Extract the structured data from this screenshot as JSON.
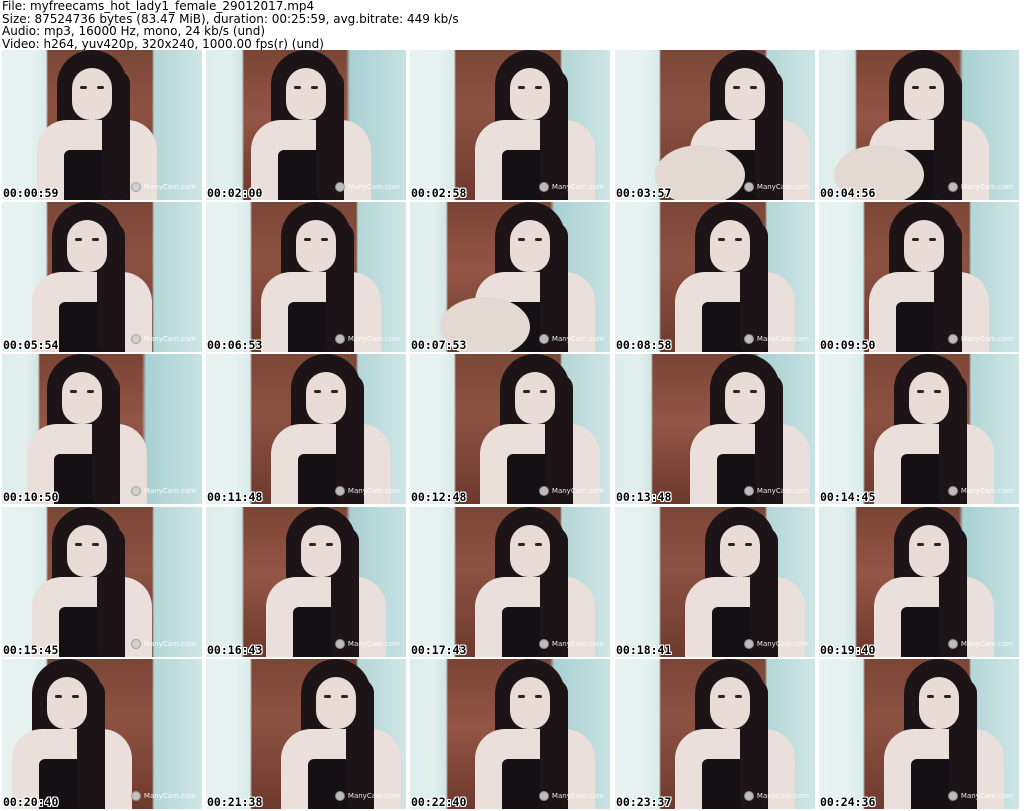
{
  "header": {
    "file_line": "File: myfreecams_hot_lady1_female_29012017.mp4",
    "size_line": "Size: 87524736 bytes (83.47 MiB), duration: 00:25:59, avg.bitrate: 449 kb/s",
    "audio_line": "Audio: mp3, 16000 Hz, mono, 24 kb/s (und)",
    "video_line": "Video: h264, yuv420p, 320x240, 1000.00 fps(r) (und)"
  },
  "watermark_text": "ManyCam.com",
  "thumbnails": [
    {
      "ts": "00:00:59"
    },
    {
      "ts": "00:02:00"
    },
    {
      "ts": "00:02:58"
    },
    {
      "ts": "00:03:57"
    },
    {
      "ts": "00:04:56"
    },
    {
      "ts": "00:05:54"
    },
    {
      "ts": "00:06:53"
    },
    {
      "ts": "00:07:53"
    },
    {
      "ts": "00:08:58"
    },
    {
      "ts": "00:09:50"
    },
    {
      "ts": "00:10:50"
    },
    {
      "ts": "00:11:48"
    },
    {
      "ts": "00:12:48"
    },
    {
      "ts": "00:13:48"
    },
    {
      "ts": "00:14:45"
    },
    {
      "ts": "00:15:45"
    },
    {
      "ts": "00:16:43"
    },
    {
      "ts": "00:17:43"
    },
    {
      "ts": "00:18:41"
    },
    {
      "ts": "00:19:40"
    },
    {
      "ts": "00:20:40"
    },
    {
      "ts": "00:21:38"
    },
    {
      "ts": "00:22:40"
    },
    {
      "ts": "00:23:37"
    },
    {
      "ts": "00:24:36"
    }
  ],
  "colors": {
    "background": "#ffffff",
    "wall_brick": "#8c5242",
    "wall_light": "#e6f2f0",
    "hair": "#1c1416",
    "dress": "#141014",
    "skin": "#eadfda"
  }
}
